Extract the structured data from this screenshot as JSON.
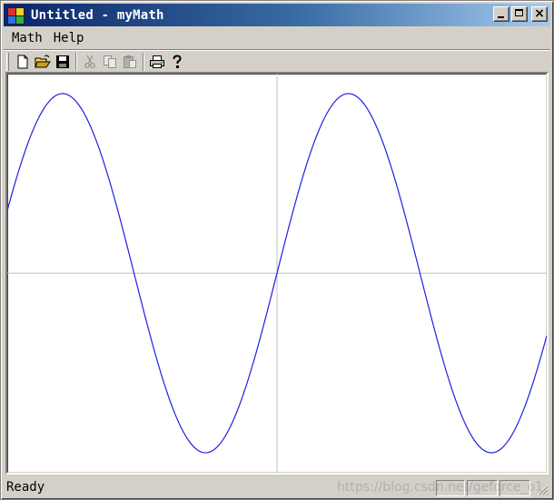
{
  "window": {
    "title": "Untitled - myMath",
    "icons": {
      "app": "app-blocks-icon",
      "minimize": "minimize-icon",
      "maximize": "maximize-icon",
      "close": "close-icon"
    },
    "close_glyph": "×"
  },
  "menubar": {
    "items": [
      {
        "label": "Math"
      },
      {
        "label": "Help"
      }
    ]
  },
  "toolbar": {
    "tools": [
      {
        "name": "new-icon",
        "enabled": true
      },
      {
        "name": "open-icon",
        "enabled": true
      },
      {
        "name": "save-icon",
        "enabled": true
      },
      {
        "name": "cut-icon",
        "enabled": false
      },
      {
        "name": "copy-icon",
        "enabled": false
      },
      {
        "name": "paste-icon",
        "enabled": false
      },
      {
        "name": "print-icon",
        "enabled": true
      },
      {
        "name": "help-icon",
        "enabled": true
      }
    ]
  },
  "chart_data": {
    "type": "line",
    "function": "sin",
    "x_range_cycles": [
      -1,
      1
    ],
    "amplitude_ratio": 0.45,
    "phase_ratio": 0.25,
    "colors": {
      "curve": "#2020e0",
      "axes": "#c0c0c0",
      "background": "#ffffff"
    }
  },
  "statusbar": {
    "text": "Ready",
    "watermark": "https://blog.csdn.net/geforce_o1"
  }
}
